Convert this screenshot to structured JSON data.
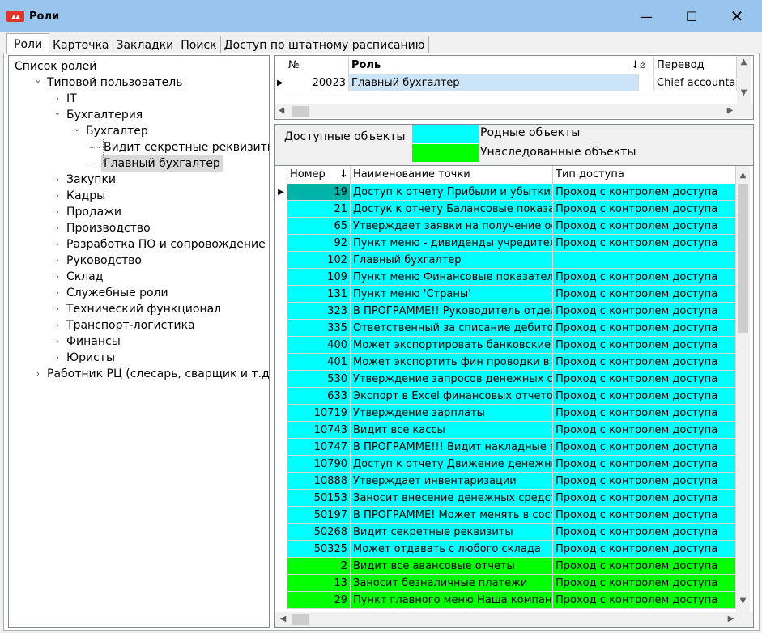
{
  "window": {
    "title": "Роли",
    "app_icon": "app-logo-icon",
    "controls": {
      "minimize": "—",
      "maximize": "☐",
      "close": "✕"
    }
  },
  "tabs": [
    {
      "label": "Роли",
      "active": true
    },
    {
      "label": "Карточка",
      "active": false
    },
    {
      "label": "Закладки",
      "active": false
    },
    {
      "label": "Поиск",
      "active": false
    },
    {
      "label": "Доступ по штатному расписанию",
      "active": false
    }
  ],
  "tree": {
    "items": [
      {
        "label": "Список ролей",
        "level": 0,
        "expanded": true,
        "has_children": true
      },
      {
        "label": "Типовой пользователь",
        "level": 1,
        "expanded": true,
        "has_children": true
      },
      {
        "label": "IT",
        "level": 2,
        "expanded": false,
        "has_children": true
      },
      {
        "label": "Бухгалтерия",
        "level": 2,
        "expanded": true,
        "has_children": true
      },
      {
        "label": "Бухгалтер",
        "level": 3,
        "expanded": true,
        "has_children": true
      },
      {
        "label": "Видит секретные реквизиты",
        "level": 4,
        "has_children": false
      },
      {
        "label": "Главный бухгалтер",
        "level": 4,
        "has_children": false,
        "selected": true
      },
      {
        "label": "Закупки",
        "level": 2,
        "expanded": false,
        "has_children": true
      },
      {
        "label": "Кадры",
        "level": 2,
        "expanded": false,
        "has_children": true
      },
      {
        "label": "Продажи",
        "level": 2,
        "expanded": false,
        "has_children": true
      },
      {
        "label": "Производство",
        "level": 2,
        "expanded": false,
        "has_children": true
      },
      {
        "label": "Разработка ПО и сопровождение",
        "level": 2,
        "expanded": false,
        "has_children": true
      },
      {
        "label": "Руководство",
        "level": 2,
        "expanded": false,
        "has_children": true
      },
      {
        "label": "Склад",
        "level": 2,
        "expanded": false,
        "has_children": true
      },
      {
        "label": "Служебные роли",
        "level": 2,
        "expanded": false,
        "has_children": true
      },
      {
        "label": "Технический функционал",
        "level": 2,
        "expanded": false,
        "has_children": true
      },
      {
        "label": "Транспорт-логистика",
        "level": 2,
        "expanded": false,
        "has_children": true
      },
      {
        "label": "Финансы",
        "level": 2,
        "expanded": false,
        "has_children": true
      },
      {
        "label": "Юристы",
        "level": 2,
        "expanded": false,
        "has_children": true
      },
      {
        "label": "Работник РЦ (слесарь, сварщик и т.д.)",
        "level": 1,
        "expanded": false,
        "has_children": true
      }
    ]
  },
  "roles_grid": {
    "columns": {
      "num": "№",
      "role": "Роль",
      "translation": "Перевод"
    },
    "rows": [
      {
        "num": "20023",
        "role": "Главный бухгалтер",
        "translation": "Chief accountan"
      }
    ]
  },
  "legend": {
    "title": "Доступные объекты",
    "native_label": "Родные объекты",
    "inherited_label": "Унаследованные объекты",
    "native_color": "#00ffff",
    "inherited_color": "#00ff00"
  },
  "objects_grid": {
    "columns": {
      "number": "Номер",
      "name": "Наименование точки",
      "access": "Тип доступа"
    },
    "rows": [
      {
        "number": "19",
        "name": "Доступ к отчету Прибыли и убытки",
        "access": "Проход с контролем доступа",
        "kind": "native",
        "current": true
      },
      {
        "number": "21",
        "name": "Достук к отчету Балансовые показат",
        "access": "Проход с контролем доступа",
        "kind": "native"
      },
      {
        "number": "65",
        "name": "Утверждает заявки на получение осн",
        "access": "Проход с контролем доступа",
        "kind": "native"
      },
      {
        "number": "92",
        "name": "Пункт меню - дивиденды учредителям",
        "access": "Проход с контролем доступа",
        "kind": "native"
      },
      {
        "number": "102",
        "name": "Главный бухгалтер",
        "access": "",
        "kind": "native"
      },
      {
        "number": "109",
        "name": "Пункт меню Финансовые показатели",
        "access": "Проход с контролем доступа",
        "kind": "native"
      },
      {
        "number": "131",
        "name": "Пункт меню 'Страны'",
        "access": "Проход с контролем доступа",
        "kind": "native"
      },
      {
        "number": "323",
        "name": "В ПРОГРАММЕ!! Руководитель отдела",
        "access": "Проход с контролем доступа",
        "kind": "native"
      },
      {
        "number": "335",
        "name": "Ответственный за списание дебитор",
        "access": "Проход с контролем доступа",
        "kind": "native"
      },
      {
        "number": "400",
        "name": "Может экспортировать банковские кр",
        "access": "Проход с контролем доступа",
        "kind": "native"
      },
      {
        "number": "401",
        "name": "Может экспортить фин проводки в Ex",
        "access": "Проход с контролем доступа",
        "kind": "native"
      },
      {
        "number": "530",
        "name": "Утверждение запросов денежных сум",
        "access": "Проход с контролем доступа",
        "kind": "native"
      },
      {
        "number": "633",
        "name": "Экспорт в Excel финансовых отчетов",
        "access": "Проход с контролем доступа",
        "kind": "native"
      },
      {
        "number": "10719",
        "name": "Утверждение зарплаты",
        "access": "Проход с контролем доступа",
        "kind": "native"
      },
      {
        "number": "10743",
        "name": "Видит все кассы",
        "access": "Проход с контролем доступа",
        "kind": "native"
      },
      {
        "number": "10747",
        "name": "В ПРОГРАММЕ!!! Видит накладные по",
        "access": "Проход с контролем доступа",
        "kind": "native"
      },
      {
        "number": "10790",
        "name": "Доступ к отчету Движение денежных с",
        "access": "Проход с контролем доступа",
        "kind": "native"
      },
      {
        "number": "10888",
        "name": "Утверждает инвентаризации",
        "access": "Проход с контролем доступа",
        "kind": "native"
      },
      {
        "number": "50153",
        "name": "Заносит внесение денежных средств",
        "access": "Проход с контролем доступа",
        "kind": "native"
      },
      {
        "number": "50197",
        "name": "В ПРОГРАММЕ! Может менять в состо",
        "access": "Проход с контролем доступа",
        "kind": "native"
      },
      {
        "number": "50268",
        "name": "Видит секретные реквизиты",
        "access": "Проход с контролем доступа",
        "kind": "native"
      },
      {
        "number": "50325",
        "name": "Может отдавать с любого склада",
        "access": "Проход с контролем доступа",
        "kind": "native"
      },
      {
        "number": "2",
        "name": "Видит все авансовые отчеты",
        "access": "Проход с контролем доступа",
        "kind": "inherited"
      },
      {
        "number": "13",
        "name": "Заносит безналичные платежи",
        "access": "Проход с контролем доступа",
        "kind": "inherited"
      },
      {
        "number": "29",
        "name": "Пункт главного меню Наша компания",
        "access": "Проход с контролем доступа",
        "kind": "inherited"
      }
    ]
  }
}
